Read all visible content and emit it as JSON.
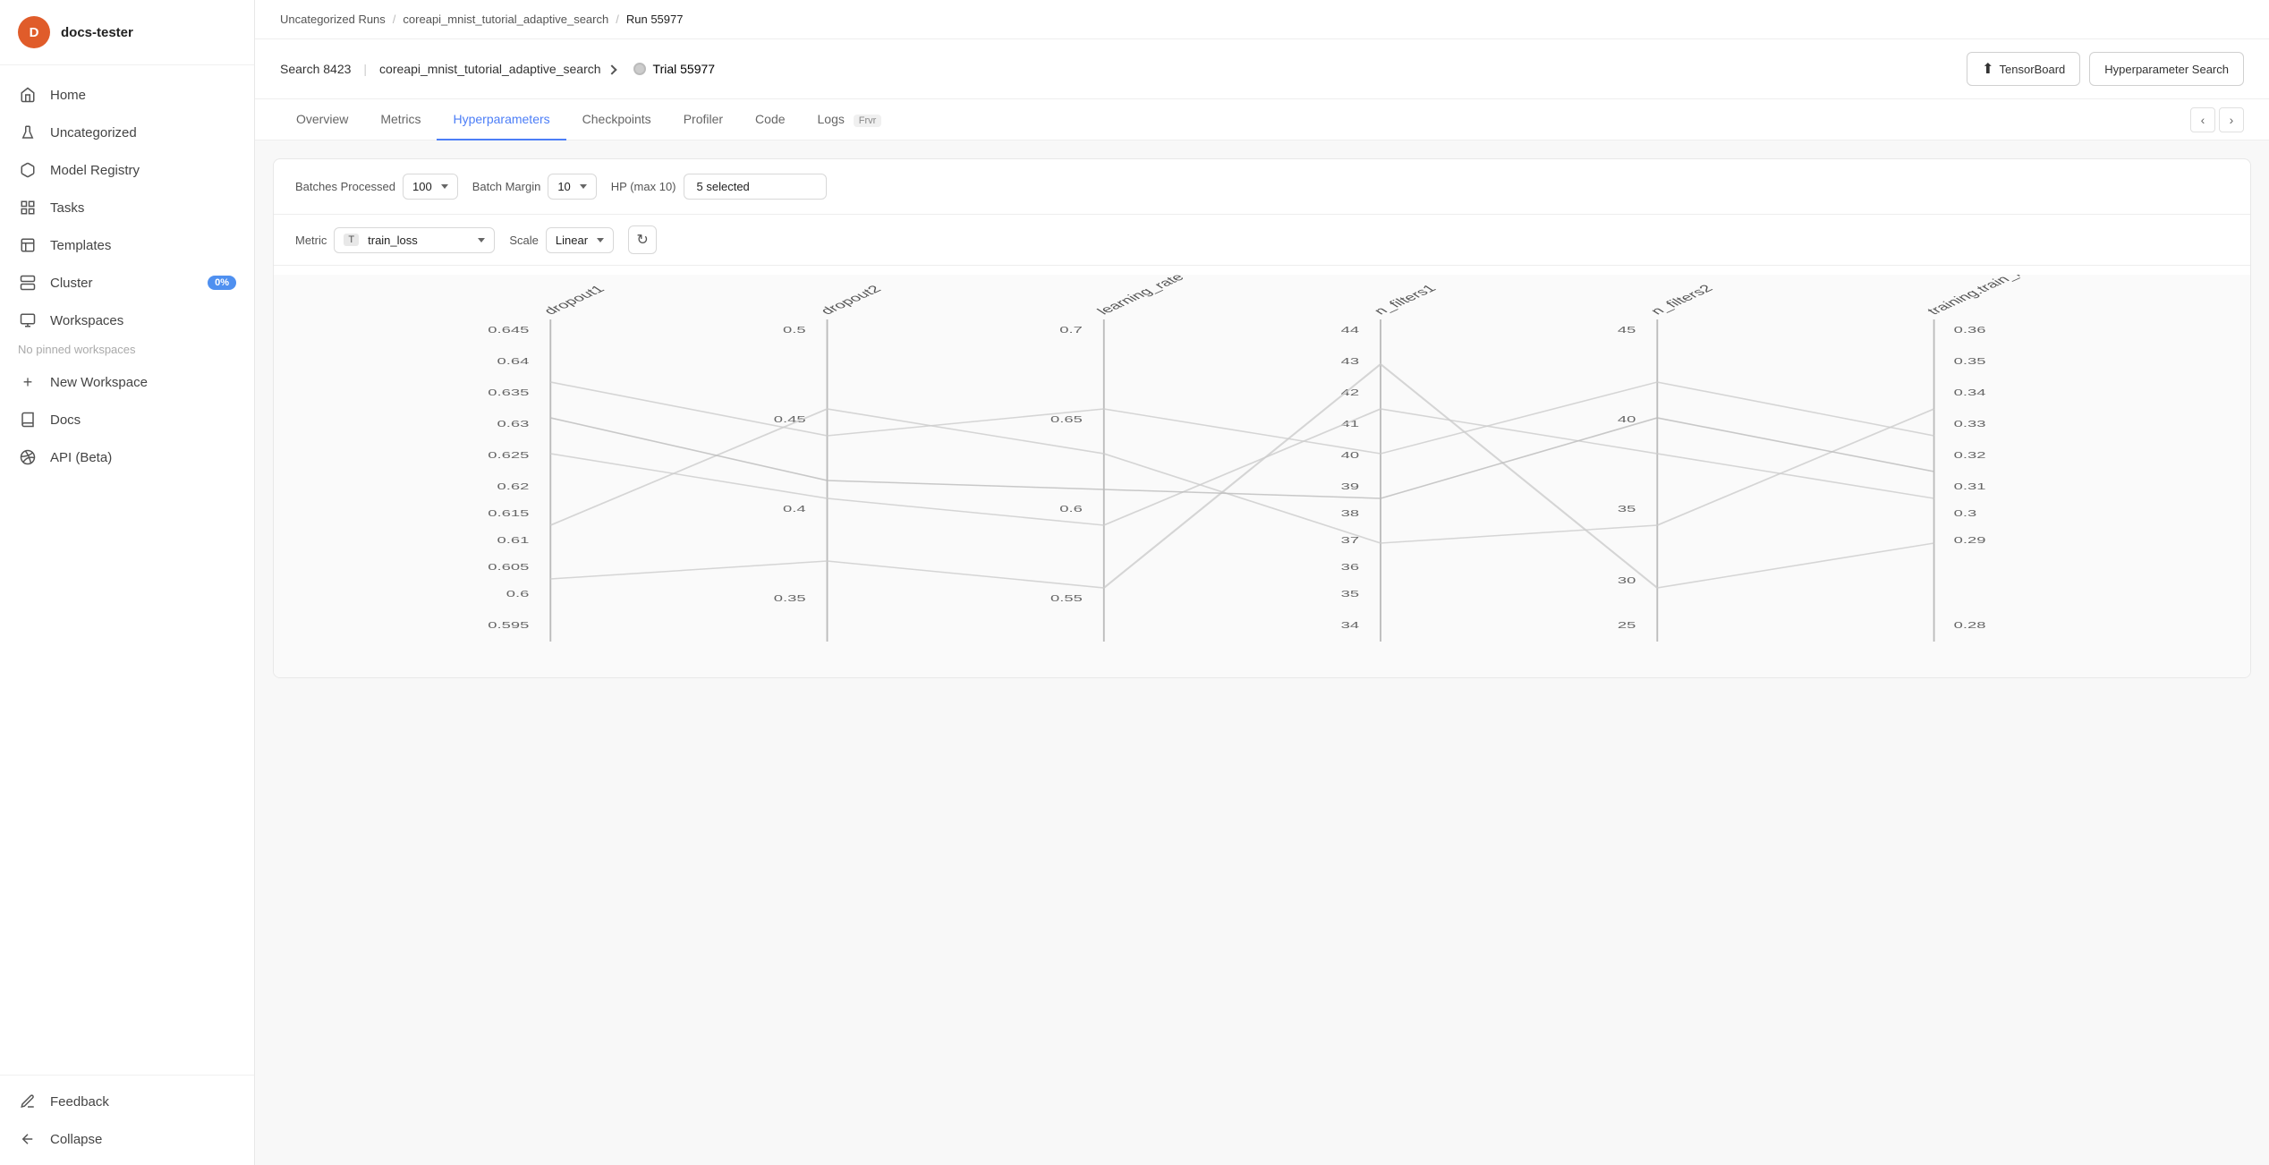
{
  "user": {
    "initial": "D",
    "name": "docs-tester"
  },
  "sidebar": {
    "items": [
      {
        "id": "home",
        "label": "Home",
        "icon": "home"
      },
      {
        "id": "uncategorized",
        "label": "Uncategorized",
        "icon": "beaker"
      },
      {
        "id": "model-registry",
        "label": "Model Registry",
        "icon": "cube"
      },
      {
        "id": "tasks",
        "label": "Tasks",
        "icon": "tasks"
      },
      {
        "id": "templates",
        "label": "Templates",
        "icon": "templates"
      },
      {
        "id": "cluster",
        "label": "Cluster",
        "icon": "cluster",
        "badge": "0%"
      },
      {
        "id": "workspaces",
        "label": "Workspaces",
        "icon": "workspaces"
      }
    ],
    "no_pinned": "No pinned workspaces",
    "new_workspace": "New Workspace",
    "docs": "Docs",
    "api_beta": "API (Beta)",
    "feedback": "Feedback",
    "collapse": "Collapse"
  },
  "breadcrumb": {
    "parts": [
      "Uncategorized Runs",
      "coreapi_mnist_tutorial_adaptive_search",
      "Run 55977"
    ]
  },
  "topbar": {
    "search_label": "Search 8423",
    "search_name": "coreapi_mnist_tutorial_adaptive_search",
    "trial_label": "Trial 55977",
    "tensorboard_btn": "TensorBoard",
    "hyperparameter_btn": "Hyperparameter Search"
  },
  "tabs": {
    "items": [
      {
        "id": "overview",
        "label": "Overview",
        "active": false
      },
      {
        "id": "metrics",
        "label": "Metrics",
        "active": false
      },
      {
        "id": "hyperparameters",
        "label": "Hyperparameters",
        "active": true
      },
      {
        "id": "checkpoints",
        "label": "Checkpoints",
        "active": false
      },
      {
        "id": "profiler",
        "label": "Profiler",
        "active": false
      },
      {
        "id": "code",
        "label": "Code",
        "active": false
      },
      {
        "id": "logs",
        "label": "Logs",
        "active": false,
        "badge": "Frvr"
      }
    ]
  },
  "filters": {
    "batches_label": "Batches Processed",
    "batches_value": "100",
    "margin_label": "Batch Margin",
    "margin_value": "10",
    "hp_label": "HP (max 10)",
    "hp_value": "5 selected",
    "metric_label": "Metric",
    "metric_value": "train_loss",
    "metric_type": "T",
    "scale_label": "Scale",
    "scale_value": "Linear"
  },
  "chart": {
    "axes": [
      {
        "id": "dropout1",
        "label": "dropout1",
        "ticks": [
          "0.645",
          "0.64",
          "0.635",
          "0.63",
          "0.625",
          "0.62",
          "0.615",
          "0.61",
          "0.605",
          "0.6",
          "0.595"
        ],
        "x_pct": 14
      },
      {
        "id": "dropout2",
        "label": "dropout2",
        "ticks": [
          "0.5",
          "0.45",
          "0.4",
          "0.35"
        ],
        "x_pct": 28
      },
      {
        "id": "learning_rate",
        "label": "learning_rate",
        "ticks": [
          "0.7",
          "0.65",
          "0.6",
          "0.55"
        ],
        "x_pct": 42
      },
      {
        "id": "n_filters1",
        "label": "n_filters1",
        "ticks": [
          "44",
          "43",
          "42",
          "41",
          "40",
          "39",
          "38",
          "37",
          "36",
          "35",
          "34"
        ],
        "x_pct": 56
      },
      {
        "id": "n_filters2",
        "label": "n_filters2",
        "ticks": [
          "45",
          "40",
          "35",
          "30",
          "25"
        ],
        "x_pct": 70
      },
      {
        "id": "training_train_loss",
        "label": "training.train_loss",
        "ticks": [
          "0.36",
          "0.35",
          "0.34",
          "0.33",
          "0.32",
          "0.31",
          "0.3",
          "0.29",
          "0.28"
        ],
        "x_pct": 84
      }
    ]
  }
}
